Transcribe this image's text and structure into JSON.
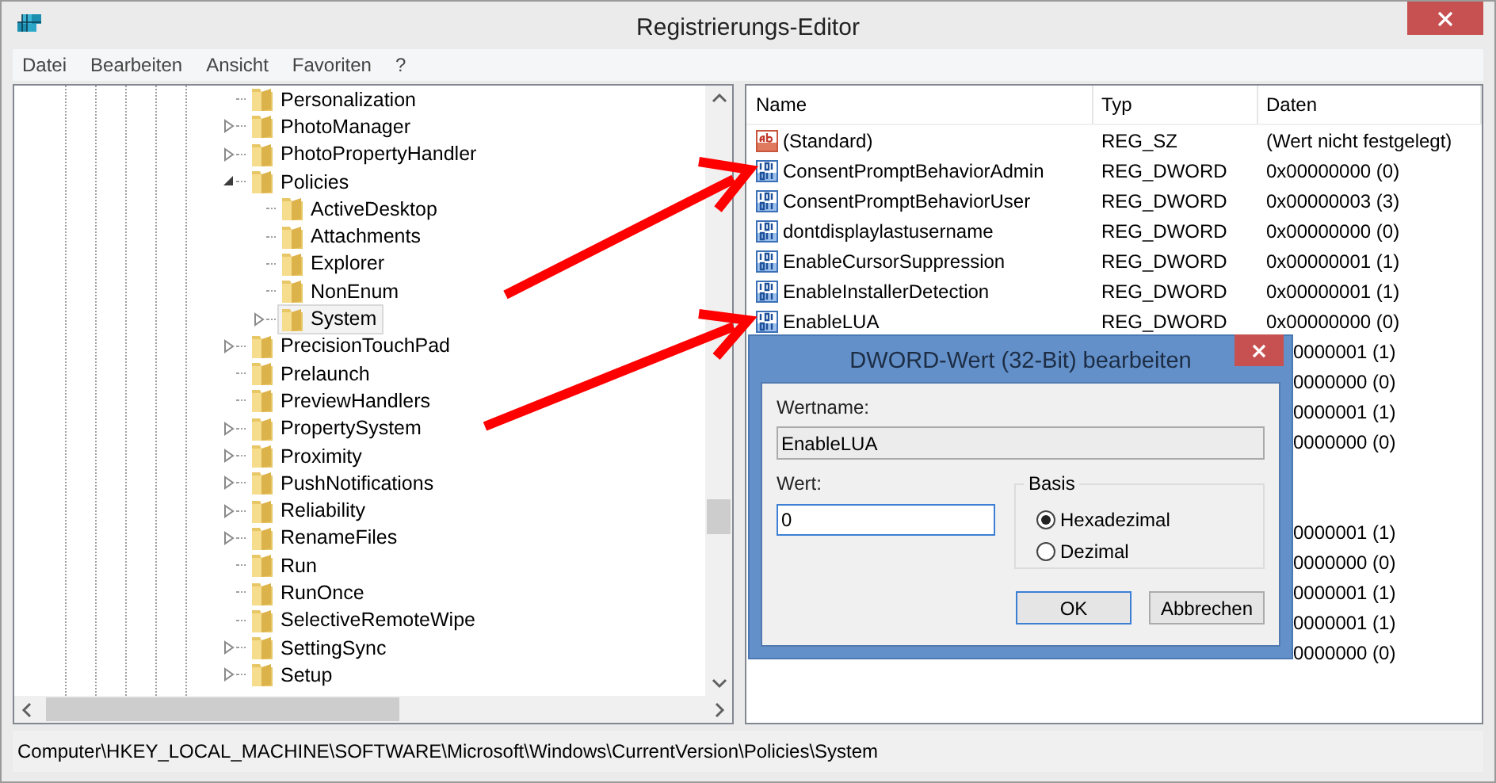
{
  "window": {
    "title": "Registrierungs-Editor"
  },
  "menu": [
    "Datei",
    "Bearbeiten",
    "Ansicht",
    "Favoriten",
    "?"
  ],
  "tree": {
    "items": [
      {
        "label": "Personalization",
        "expandable": false,
        "expanded": false,
        "selected": false
      },
      {
        "label": "PhotoManager",
        "expandable": true,
        "expanded": false,
        "selected": false
      },
      {
        "label": "PhotoPropertyHandler",
        "expandable": true,
        "expanded": false,
        "selected": false
      },
      {
        "label": "Policies",
        "expanded": true,
        "selected": false,
        "children": [
          {
            "label": "ActiveDesktop",
            "expandable": false,
            "expanded": false,
            "selected": false
          },
          {
            "label": "Attachments",
            "expandable": false,
            "expanded": false,
            "selected": false
          },
          {
            "label": "Explorer",
            "expandable": false,
            "expanded": false,
            "selected": false
          },
          {
            "label": "NonEnum",
            "expandable": false,
            "expanded": false,
            "selected": false
          },
          {
            "label": "System",
            "expandable": true,
            "expanded": false,
            "selected": true
          }
        ]
      },
      {
        "label": "PrecisionTouchPad",
        "expandable": true,
        "expanded": false,
        "selected": false
      },
      {
        "label": "Prelaunch",
        "expandable": false,
        "expanded": false,
        "selected": false
      },
      {
        "label": "PreviewHandlers",
        "expandable": false,
        "expanded": false,
        "selected": false
      },
      {
        "label": "PropertySystem",
        "expandable": true,
        "expanded": false,
        "selected": false
      },
      {
        "label": "Proximity",
        "expandable": true,
        "expanded": false,
        "selected": false
      },
      {
        "label": "PushNotifications",
        "expandable": true,
        "expanded": false,
        "selected": false
      },
      {
        "label": "Reliability",
        "expandable": true,
        "expanded": false,
        "selected": false
      },
      {
        "label": "RenameFiles",
        "expandable": true,
        "expanded": false,
        "selected": false
      },
      {
        "label": "Run",
        "expandable": false,
        "expanded": false,
        "selected": false
      },
      {
        "label": "RunOnce",
        "expandable": false,
        "expanded": false,
        "selected": false
      },
      {
        "label": "SelectiveRemoteWipe",
        "expandable": false,
        "expanded": false,
        "selected": false
      },
      {
        "label": "SettingSync",
        "expandable": true,
        "expanded": false,
        "selected": false
      },
      {
        "label": "Setup",
        "expandable": true,
        "expanded": false,
        "selected": false
      }
    ]
  },
  "values": {
    "columns": [
      "Name",
      "Typ",
      "Daten"
    ],
    "rows": [
      {
        "kind": "string",
        "name": "(Standard)",
        "type": "REG_SZ",
        "data": "(Wert nicht festgelegt)"
      },
      {
        "kind": "dword",
        "name": "ConsentPromptBehaviorAdmin",
        "type": "REG_DWORD",
        "data": "0x00000000 (0)"
      },
      {
        "kind": "dword",
        "name": "ConsentPromptBehaviorUser",
        "type": "REG_DWORD",
        "data": "0x00000003 (3)"
      },
      {
        "kind": "dword",
        "name": "dontdisplaylastusername",
        "type": "REG_DWORD",
        "data": "0x00000000 (0)"
      },
      {
        "kind": "dword",
        "name": "EnableCursorSuppression",
        "type": "REG_DWORD",
        "data": "0x00000001 (1)"
      },
      {
        "kind": "dword",
        "name": "EnableInstallerDetection",
        "type": "REG_DWORD",
        "data": "0x00000001 (1)"
      },
      {
        "kind": "dword",
        "name": "EnableLUA",
        "type": "REG_DWORD",
        "data": "0x00000000 (0)"
      }
    ],
    "covered_rows_top": [
      "0000001 (1)",
      "0000000 (0)",
      "0000001 (1)",
      "0000000 (0)"
    ],
    "covered_rows_bottom": [
      "0000001 (1)",
      "0000000 (0)",
      "0000001 (1)",
      "0000001 (1)",
      "0000000 (0)"
    ]
  },
  "status_bar": "Computer\\HKEY_LOCAL_MACHINE\\SOFTWARE\\Microsoft\\Windows\\CurrentVersion\\Policies\\System",
  "dialog": {
    "title": "DWORD-Wert (32-Bit) bearbeiten",
    "name_label": "Wertname:",
    "name_value": "EnableLUA",
    "value_label": "Wert:",
    "value": "0",
    "base_label": "Basis",
    "base_options": [
      {
        "label": "Hexadezimal",
        "selected": true
      },
      {
        "label": "Dezimal",
        "selected": false
      }
    ],
    "buttons": [
      "OK",
      "Abbrechen"
    ]
  }
}
